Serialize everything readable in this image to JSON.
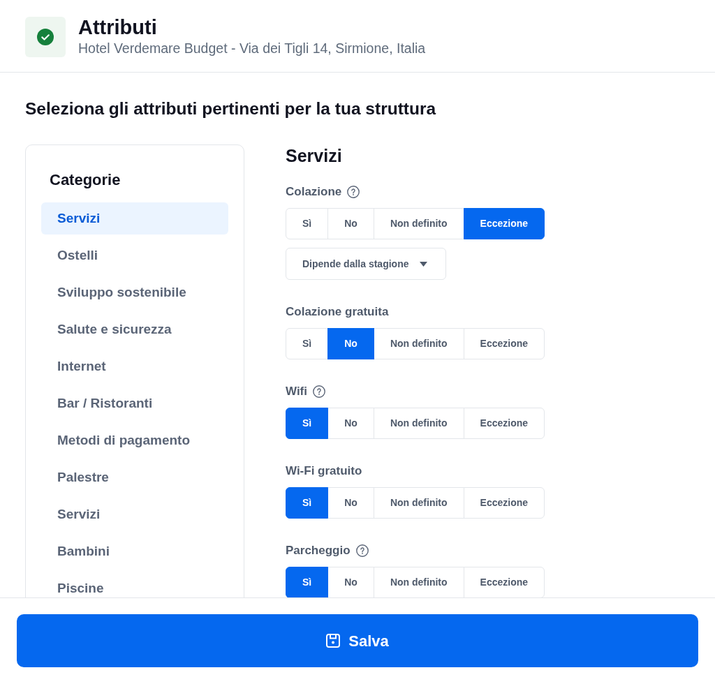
{
  "header": {
    "title": "Attributi",
    "subtitle": "Hotel Verdemare Budget - Via dei Tigli 14, Sirmione, Italia"
  },
  "heading": "Seleziona gli attributi pertinenti per la tua struttura",
  "sidebar": {
    "title": "Categorie",
    "items": [
      {
        "label": "Servizi",
        "selected": true
      },
      {
        "label": "Ostelli",
        "selected": false
      },
      {
        "label": "Sviluppo sostenibile",
        "selected": false
      },
      {
        "label": "Salute e sicurezza",
        "selected": false
      },
      {
        "label": "Internet",
        "selected": false
      },
      {
        "label": "Bar / Ristoranti",
        "selected": false
      },
      {
        "label": "Metodi di pagamento",
        "selected": false
      },
      {
        "label": "Palestre",
        "selected": false
      },
      {
        "label": "Servizi",
        "selected": false
      },
      {
        "label": "Bambini",
        "selected": false
      },
      {
        "label": "Piscine",
        "selected": false
      }
    ]
  },
  "section": {
    "title": "Servizi",
    "attributes": [
      {
        "label": "Colazione",
        "help": true,
        "options": [
          {
            "label": "Sì",
            "selected": false
          },
          {
            "label": "No",
            "selected": false
          },
          {
            "label": "Non definito",
            "selected": false
          },
          {
            "label": "Eccezione",
            "selected": true
          }
        ],
        "dropdown": {
          "value": "Dipende dalla stagione"
        }
      },
      {
        "label": "Colazione gratuita",
        "help": false,
        "options": [
          {
            "label": "Sì",
            "selected": false
          },
          {
            "label": "No",
            "selected": true
          },
          {
            "label": "Non definito",
            "selected": false
          },
          {
            "label": "Eccezione",
            "selected": false
          }
        ]
      },
      {
        "label": "Wifi",
        "help": true,
        "options": [
          {
            "label": "Sì",
            "selected": true
          },
          {
            "label": "No",
            "selected": false
          },
          {
            "label": "Non definito",
            "selected": false
          },
          {
            "label": "Eccezione",
            "selected": false
          }
        ]
      },
      {
        "label": "Wi-Fi gratuito",
        "help": false,
        "options": [
          {
            "label": "Sì",
            "selected": true
          },
          {
            "label": "No",
            "selected": false
          },
          {
            "label": "Non definito",
            "selected": false
          },
          {
            "label": "Eccezione",
            "selected": false
          }
        ]
      },
      {
        "label": "Parcheggio",
        "help": true,
        "options": [
          {
            "label": "Sì",
            "selected": true
          },
          {
            "label": "No",
            "selected": false
          },
          {
            "label": "Non definito",
            "selected": false
          },
          {
            "label": "Eccezione",
            "selected": false
          }
        ]
      }
    ]
  },
  "footer": {
    "save_button": "Salva"
  }
}
